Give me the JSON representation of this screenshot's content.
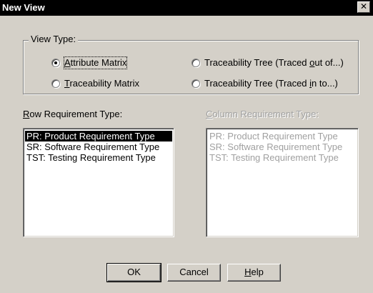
{
  "window": {
    "title": "New View",
    "close_glyph": "✕"
  },
  "view_type": {
    "legend": "View Type:",
    "options": [
      {
        "pre": "",
        "key": "A",
        "post": "ttribute Matrix",
        "checked": true
      },
      {
        "pre": "",
        "key": "T",
        "post": "raceability Matrix",
        "checked": false
      },
      {
        "pre": "Traceability Tree (Traced ",
        "key": "o",
        "post": "ut of...)",
        "checked": false
      },
      {
        "pre": "Traceability Tree (Traced ",
        "key": "i",
        "post": "n to...)",
        "checked": false
      }
    ]
  },
  "row_req": {
    "label_key": "R",
    "label_rest": "ow Requirement Type:",
    "items": [
      "PR: Product Requirement Type",
      "SR: Software Requirement Type",
      "TST: Testing Requirement Type"
    ],
    "selected_index": 0
  },
  "col_req": {
    "label_key": "C",
    "label_rest": "olumn Requirement Type:",
    "items": [
      "PR: Product Requirement Type",
      "SR: Software Requirement Type",
      "TST: Testing Requirement Type"
    ],
    "disabled": true
  },
  "buttons": {
    "ok": "OK",
    "cancel": "Cancel",
    "help_key": "H",
    "help_rest": "elp"
  },
  "colors": {
    "face": "#d4d0c8",
    "titlebar": "#000000",
    "disabled_text": "#a0a0a0"
  }
}
